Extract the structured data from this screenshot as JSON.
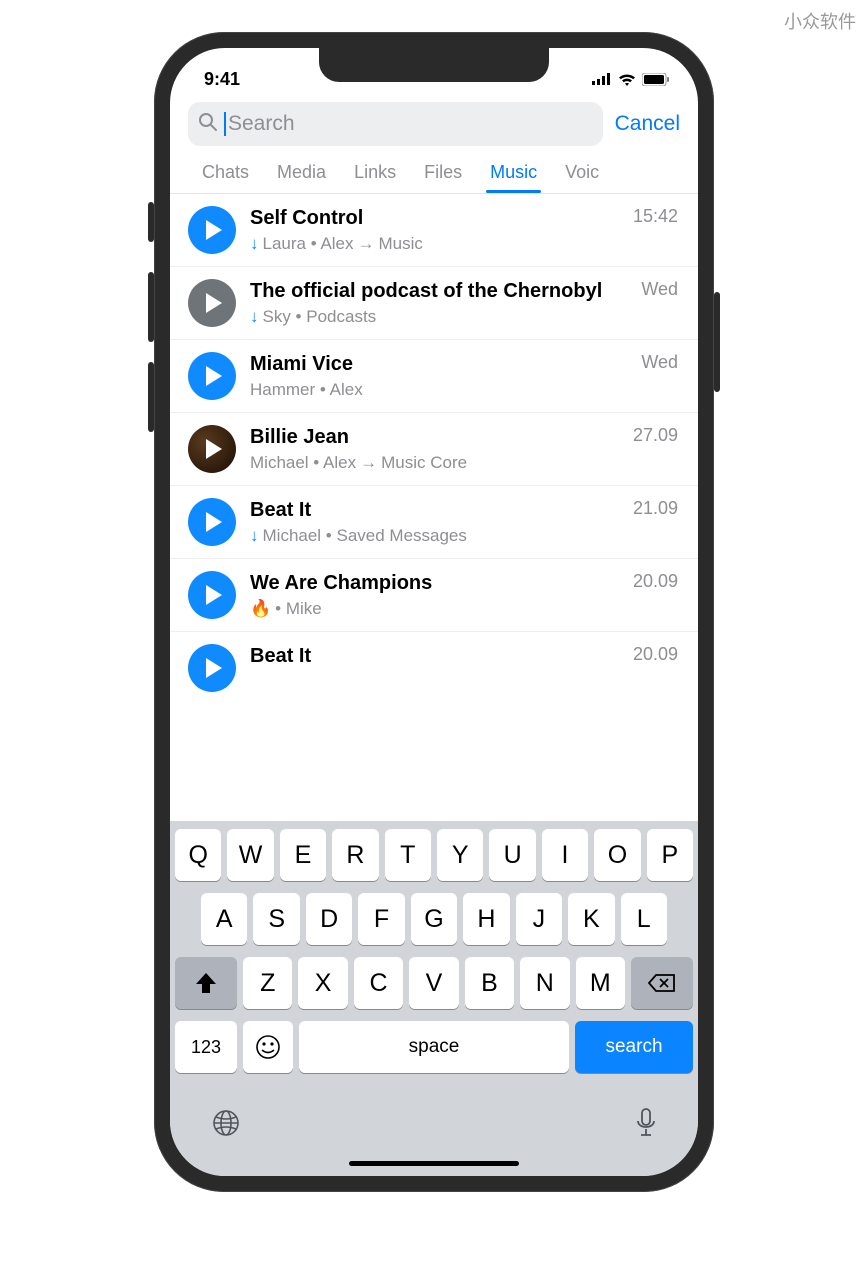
{
  "watermark": "小众软件",
  "status": {
    "time": "9:41"
  },
  "search": {
    "placeholder": "Search",
    "cancel": "Cancel"
  },
  "tabs": [
    "Chats",
    "Media",
    "Links",
    "Files",
    "Music",
    "Voic"
  ],
  "active_tab": "Music",
  "items": [
    {
      "title": "Self Control",
      "time": "15:42",
      "download": true,
      "sub_pre": "Laura • Alex",
      "forward_to": "Music",
      "avatar": "play"
    },
    {
      "title": "The official podcast of the Chernobyl",
      "time": "Wed",
      "download": true,
      "sub_pre": "Sky • Podcasts",
      "forward_to": null,
      "avatar": "img1"
    },
    {
      "title": "Miami Vice",
      "time": "Wed",
      "download": false,
      "sub_pre": "Hammer • Alex",
      "forward_to": null,
      "avatar": "play"
    },
    {
      "title": "Billie Jean",
      "time": "27.09",
      "download": false,
      "sub_pre": "Michael • Alex",
      "forward_to": "Music Core",
      "avatar": "img2"
    },
    {
      "title": "Beat It",
      "time": "21.09",
      "download": true,
      "sub_pre": "Michael • Saved Messages",
      "forward_to": null,
      "avatar": "play"
    },
    {
      "title": "We Are Champions",
      "time": "20.09",
      "download": false,
      "emoji": "🔥",
      "sub_pre": " • Mike",
      "forward_to": null,
      "avatar": "play"
    },
    {
      "title": "Beat It",
      "time": "20.09",
      "download": false,
      "sub_pre": "",
      "forward_to": null,
      "avatar": "play"
    }
  ],
  "keyboard": {
    "row1": [
      "Q",
      "W",
      "E",
      "R",
      "T",
      "Y",
      "U",
      "I",
      "O",
      "P"
    ],
    "row2": [
      "A",
      "S",
      "D",
      "F",
      "G",
      "H",
      "J",
      "K",
      "L"
    ],
    "row3": [
      "Z",
      "X",
      "C",
      "V",
      "B",
      "N",
      "M"
    ],
    "k123": "123",
    "space": "space",
    "search": "search"
  }
}
